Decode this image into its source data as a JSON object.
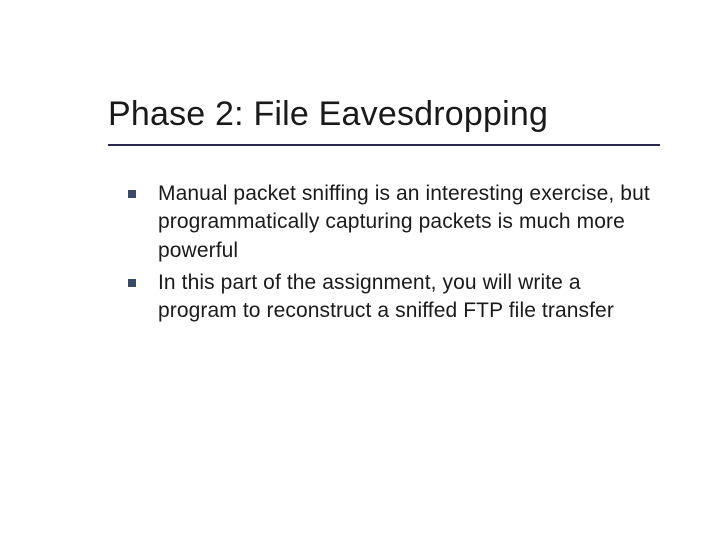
{
  "slide": {
    "title": "Phase 2: File Eavesdropping",
    "bullets": [
      {
        "text": "Manual packet sniffing is an interesting exercise, but programmatically capturing packets is much more powerful"
      },
      {
        "text": "In this part of the assignment, you will write a program to reconstruct a sniffed FTP file transfer"
      }
    ]
  }
}
